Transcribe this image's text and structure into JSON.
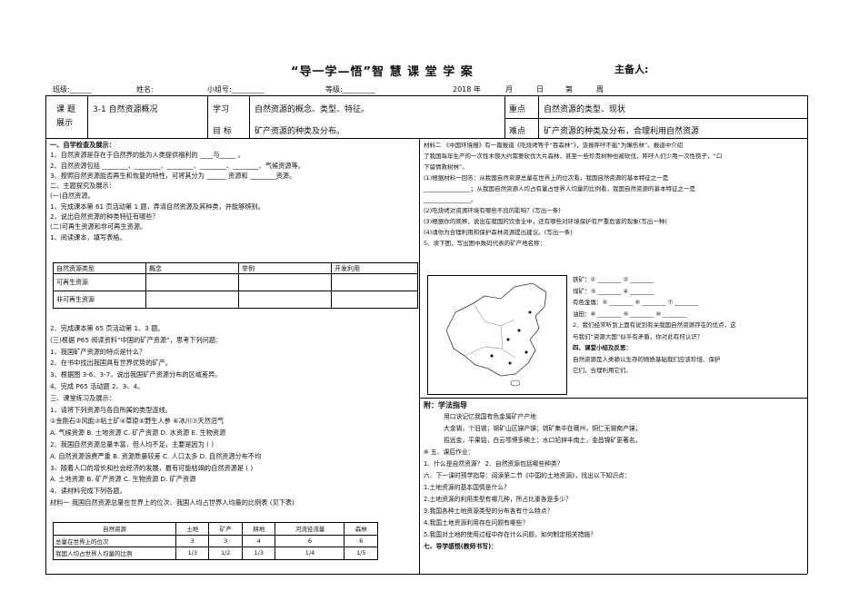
{
  "header": {
    "title": "“导一学—悟”智 慧 课 堂 学 案",
    "preparer": "主备人:"
  },
  "meta": [
    "班级:______",
    "姓名:",
    "小组号:_________",
    "等级:_________",
    "2018 年",
    "月",
    "日",
    "第",
    "周"
  ],
  "topic": {
    "label1": "课 题",
    "label2": "展示",
    "value": "3-1 自然资源概况",
    "goal_label1": "学习",
    "goal_label2": "目 标",
    "goal1": "自然资源的概念、类型、特征。",
    "goal2": "矿产资源的种类及分布。",
    "key_label": "重点",
    "key_value": "自然资源的类型、现状",
    "diff_label": "难点",
    "diff_value": "矿产资源的种类及分布，合理利用自然资源"
  },
  "left_lines": [
    "一、自学检查及展示：",
    "1、自然资源是存在于自然界的能为人类提供福利的 ____与_____ 。",
    "2、自然资源包括 ________、________、________、________、________、气候资源等。",
    "3、按照自然资源能否再生和恢复的特性，可将其分为 ______ 资源和 ________资源。",
    "二、主题探究及展示：",
    "(一)自然资源。",
    "1、完成课本第 61 页活动第 1 题，弄清自然资源及其种类，并能够辨别。",
    "2、说出自然资源的种类特征有哪些？",
    "(二)可再生资源和非可再生资源。",
    "1、阅读课本，填写表格。"
  ],
  "table1": {
    "headers": [
      "自然资源类型",
      "概念",
      "举例",
      "开发利用"
    ],
    "rows": [
      [
        "可再生资源",
        "",
        "",
        ""
      ],
      [
        "非可再生资源",
        "",
        "",
        ""
      ]
    ]
  },
  "left_lines2": [
    "2、完成课本第 65 页活动第 1、3 题。",
    "(三)根据 P65 阅读资料“中国的矿产资源”，思考下列问题：",
    "1、我国矿产资源的特点是什么？",
    "2、在书中找出我国具有世界优势的矿产。",
    "3、根据图 3-6、3-7，说出我国矿产资源分布的区域差异。",
    "4、完成 P65 活动题 2、3、4。",
    "三、课堂练习及展示：",
    "1、请将下列资源与各自所属的类型连线。",
    "①金刚石②风能③粘土矿④草原⑤野生人参  ⑥冰川⑦天然沼气",
    "A. 气候资源  B. 土地资源  C. 矿产资源  D. 水资源  E. 生物资源",
    "2、我国自然资源总量丰富，但人均不足，主要是因为 (   )",
    "A. 自然资源浪费严重   B. 资源质量较差   C. 人口太多   D. 自然资源分布不均",
    "3、随着人口的增长和社会经济的发展，最有可能枯竭的自然资源是 (   )",
    "A. 土地资源  B. 矿产资源  C. 生物资源  D. 矿产资源",
    "4、读材料完成下列各题。",
    "材料一  我国自然资源总量在世界上的位次、我国人均占世界人均量的比例表 (见下表)"
  ],
  "table2": {
    "headers": [
      "自然资源",
      "土地",
      "矿产",
      "耕地",
      "河流径流量",
      "森林"
    ],
    "rows": [
      [
        "总量在世界上的位次",
        "3",
        "3",
        "4",
        "6",
        "6"
      ],
      [
        "我国人均占世界人均量的比例",
        "1/3",
        "1/2",
        "1/3",
        "1/4",
        "1/5"
      ]
    ]
  },
  "right_lines": [
    "材料二 《中国环境报》有一篇报道《吃烧烤等于“吞森林”》，该报呼吁不能“为嘴伤林”。报道中介绍",
    "了我国每年生产的一次性木筷大约需要砍伐大片森林，甚至一些珍贵树种也被砍伐，呼吁人们少用一次性筷子，“口",
    "下留情救树林”。",
    "(1)根据材料一回答：从我国自然资源总量在世界上的位次看，我国自然资源的基本特征之一是",
    "________________；从我国自然资源人均占有量占世界人均量的比例看，我国自然资源的基本特征之一是",
    "________________。",
    "(2)吃烧烤对资源环境有哪些不良的影响？(写出一条)",
    "(3)根据你的观察，说出在我国的饮食业中，还有哪些对环境保护有严重危害的现象(写出一种)",
    "",
    "(4)请你为合理利用和保护森林资源提出建议。(写出一条)",
    "5、读下图，写出图中数码代表的矿产地名称："
  ],
  "map_labels": [
    "铁矿：① ________  ② ________",
    "煤矿：③ ________  ④ ________",
    "有色金属：⑤ ________  ⑥ ________  ⑦ ________",
    "油田：⑧ ________  ⑨ ________  ⑩ ________",
    "2、我们经常听到上面有说到有关我国自然资源存在的优点，这",
    "与我们“资源大国”似乎有矛盾，你对此有何认识？",
    "",
    "四、课堂小结及反思：",
    "自然资源是人类赖以生存的物质基础我们应该珍惜、保护",
    "它们，合理利用它们。"
  ],
  "right_lines2": [
    "附：学法指导",
    "用口诀记忆我国有色金属矿产产地",
    "大金锡，个旧锡；锡矿山区锑产锑；钨矿集中在赣州，铜仁无锡南产锑；",
    "招远金，平果铝，白云鄂博多稀土；水口铅锌丰南土，金昌镍矿更著名。",
    "※ 五、课后作业：",
    "1、什么是自然资源？   2、自然资源包括哪些种类？",
    "六、下一课时预学指导：阅读第二节《中国的土地资源》，找出以下知识点：",
    "1.土地资源的基本国情是什么？",
    "2.土地资源的利用类型有哪几种，所占比重各是多少？",
    "3.我国各种土地资源类型的分布各有什么特点？",
    "4.我国土地资源利用存在问题有哪些？",
    "5.我国对土地的使用过程中存在什么问题，如何制定相关措施？",
    "七、导学感悟(教师书写)："
  ]
}
